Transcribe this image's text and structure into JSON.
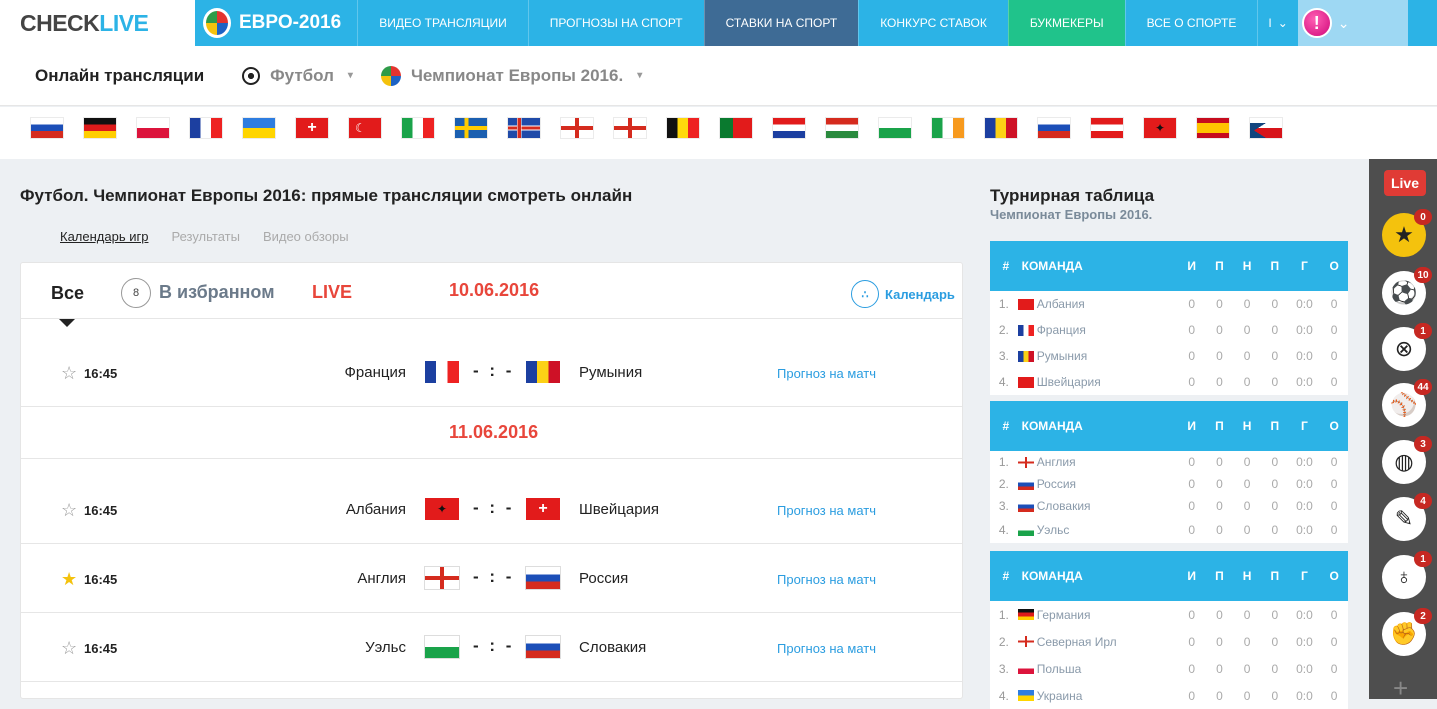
{
  "topbar": {
    "logo_a": "CHECK",
    "logo_b": "LIVE",
    "euro": "ЕВРО-2016",
    "nav": [
      "ВИДЕО ТРАНСЛЯЦИИ",
      "ПРОГНОЗЫ НА СПОРТ",
      "СТАВКИ НА СПОРТ",
      "КОНКУРС СТАВОК",
      "БУКМЕКЕРЫ",
      "ВСЕ О СПОРТЕ",
      "I"
    ],
    "avatar": "!",
    "user_caret": "⌄",
    "nav_caret": "⌄"
  },
  "subheader": {
    "title": "Онлайн трансляции",
    "sport": "Футбол",
    "championship": "Чемпионат Европы 2016.",
    "caret": "▾"
  },
  "flags": [
    "russia",
    "germany",
    "poland",
    "france",
    "ukraine",
    "switzerland",
    "turkey",
    "italy",
    "sweden",
    "iceland",
    "england",
    "northern-ireland",
    "belgium",
    "portugal",
    "croatia",
    "hungary",
    "wales",
    "ireland",
    "romania",
    "slovakia",
    "austria",
    "albania",
    "spain",
    "czech"
  ],
  "content": {
    "title": "Футбол. Чемпионат Европы 2016: прямые трансляции смотреть онлайн",
    "tabs": [
      "Календарь игр",
      "Результаты",
      "Видео обзоры"
    ]
  },
  "panel": {
    "all": "Все",
    "fav_count": "8",
    "fav": "В избранном",
    "live": "LIVE",
    "date1": "10.06.2016",
    "calendar": "Календарь",
    "cal_icon": "∴"
  },
  "match_star": "☆",
  "match_star_fav": "★",
  "matches": [
    {
      "time": "16:45",
      "home": "Франция",
      "away": "Румыния",
      "score": "- : -",
      "link": "Прогноз на матч"
    },
    {
      "time": "16:45",
      "home": "Албания",
      "away": "Швейцария",
      "score": "- : -",
      "link": "Прогноз на матч"
    },
    {
      "time": "16:45",
      "home": "Англия",
      "away": "Россия",
      "score": "- : -",
      "link": "Прогноз на матч"
    },
    {
      "time": "16:45",
      "home": "Уэльс",
      "away": "Словакия",
      "score": "- : -",
      "link": "Прогноз на матч"
    }
  ],
  "date2": "11.06.2016",
  "standings": {
    "title": "Турнирная таблица",
    "sub": "Чемпионат Европы 2016.",
    "head": {
      "hash": "#",
      "team": "КОМАНДА",
      "cols": [
        "И",
        "П",
        "Н",
        "П",
        "Г",
        "О"
      ]
    },
    "groups": [
      {
        "rows": [
          {
            "pos": "1.",
            "team": "Албания",
            "i": "0",
            "w": "0",
            "d": "0",
            "l": "0",
            "g": "0:0",
            "pts": "0"
          },
          {
            "pos": "2.",
            "team": "Франция",
            "i": "0",
            "w": "0",
            "d": "0",
            "l": "0",
            "g": "0:0",
            "pts": "0"
          },
          {
            "pos": "3.",
            "team": "Румыния",
            "i": "0",
            "w": "0",
            "d": "0",
            "l": "0",
            "g": "0:0",
            "pts": "0"
          },
          {
            "pos": "4.",
            "team": "Швейцария",
            "i": "0",
            "w": "0",
            "d": "0",
            "l": "0",
            "g": "0:0",
            "pts": "0"
          }
        ]
      },
      {
        "rows": [
          {
            "pos": "1.",
            "team": "Англия",
            "i": "0",
            "w": "0",
            "d": "0",
            "l": "0",
            "g": "0:0",
            "pts": "0"
          },
          {
            "pos": "2.",
            "team": "Россия",
            "i": "0",
            "w": "0",
            "d": "0",
            "l": "0",
            "g": "0:0",
            "pts": "0"
          },
          {
            "pos": "3.",
            "team": "Словакия",
            "i": "0",
            "w": "0",
            "d": "0",
            "l": "0",
            "g": "0:0",
            "pts": "0"
          },
          {
            "pos": "4.",
            "team": "Уэльс",
            "i": "0",
            "w": "0",
            "d": "0",
            "l": "0",
            "g": "0:0",
            "pts": "0"
          }
        ]
      },
      {
        "rows": [
          {
            "pos": "1.",
            "team": "Германия",
            "i": "0",
            "w": "0",
            "d": "0",
            "l": "0",
            "g": "0:0",
            "pts": "0"
          },
          {
            "pos": "2.",
            "team": "Северная Ирл",
            "i": "0",
            "w": "0",
            "d": "0",
            "l": "0",
            "g": "0:0",
            "pts": "0"
          },
          {
            "pos": "3.",
            "team": "Польша",
            "i": "0",
            "w": "0",
            "d": "0",
            "l": "0",
            "g": "0:0",
            "pts": "0"
          },
          {
            "pos": "4.",
            "team": "Украина",
            "i": "0",
            "w": "0",
            "d": "0",
            "l": "0",
            "g": "0:0",
            "pts": "0"
          }
        ]
      }
    ]
  },
  "sidebar": {
    "live": "Live",
    "items": [
      {
        "icon": "★",
        "badge": "0"
      },
      {
        "icon": "⚽",
        "badge": "10"
      },
      {
        "icon": "⊗",
        "badge": "1"
      },
      {
        "icon": "⚾",
        "badge": "44"
      },
      {
        "icon": "◍",
        "badge": "3"
      },
      {
        "icon": "✎",
        "badge": "4"
      },
      {
        "icon": "♁",
        "badge": "1"
      },
      {
        "icon": "✊",
        "badge": "2"
      }
    ],
    "plus": "+"
  },
  "colors": {
    "accent": "#2cb3e6",
    "live": "#e8463b",
    "link": "#2b9de0",
    "active_nav": "#3e6b95",
    "green_nav": "#20c38b"
  }
}
